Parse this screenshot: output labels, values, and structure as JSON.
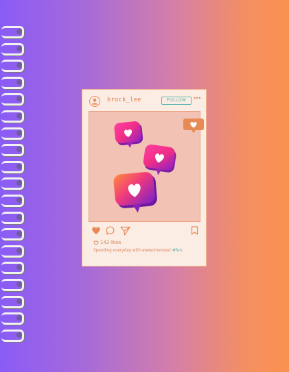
{
  "post": {
    "username": "brock_lee",
    "follow_label": "FOLLOW",
    "more_label": "•••",
    "likes_text": "143 likes",
    "caption_text": "Spending everyday with awesomeness!",
    "caption_tag": "#fun"
  },
  "colors": {
    "accent": "#e07f4c",
    "follow": "#4fa89f",
    "card_bg": "#fbece4",
    "photo_bg": "#f2c2b4"
  },
  "icons": [
    "user-icon",
    "heart-icon",
    "comment-icon",
    "send-icon",
    "bookmark-icon"
  ]
}
